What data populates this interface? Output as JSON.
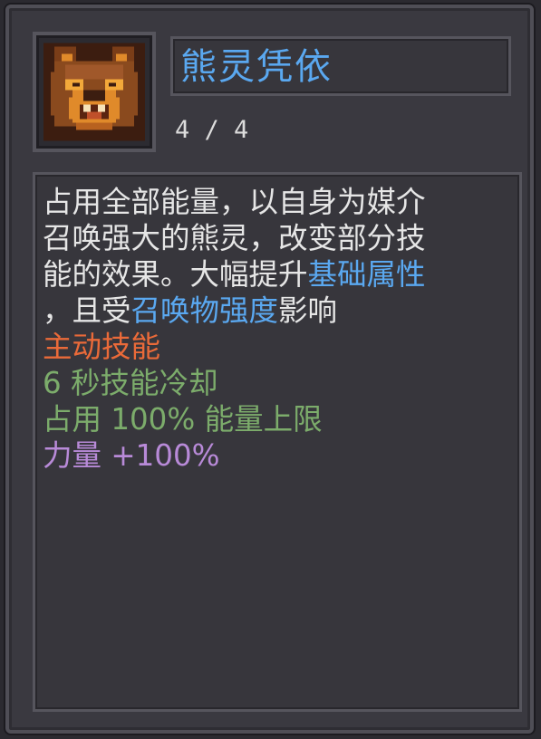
{
  "skill": {
    "icon": "bear-spirit-icon",
    "title": "熊灵凭依",
    "level": "4 / 4"
  },
  "description": {
    "line1": "占用全部能量，以自身为媒介",
    "line2": "召唤强大的熊灵，改变部分技",
    "line3_a": "能的效果。大幅提升",
    "line3_b": "基础属性",
    "line4_a": "，且受",
    "line4_b": "召唤物强度",
    "line4_c": "影响"
  },
  "stats": {
    "type": "主动技能",
    "cooldown": "6 秒技能冷却",
    "energy": "占用 100% 能量上限",
    "strength_label": "力量",
    "strength_value": "+100%"
  },
  "colors": {
    "keyword": "#5aa8f0",
    "skill_type": "#ea6a39",
    "cooldown_energy": "#7cac6b",
    "attribute": "#b88ad8"
  }
}
